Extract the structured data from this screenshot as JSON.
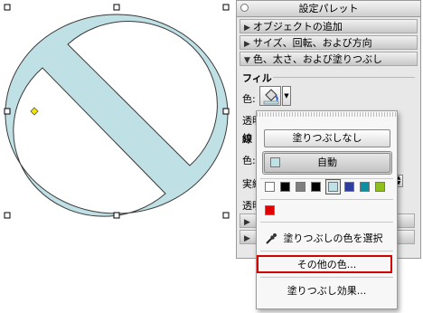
{
  "palette": {
    "title": "設定パレット",
    "sections": [
      {
        "label": "オブジェクトの追加",
        "expanded": false
      },
      {
        "label": "サイズ、回転、および方向",
        "expanded": false
      },
      {
        "label": "色、太さ、および塗りつぶし",
        "expanded": true
      }
    ],
    "fill_label": "フィル",
    "fill_color_label": "色:",
    "transparency_label_1": "透明",
    "line_label": "線",
    "line_color_label": "色:",
    "solid_label": "実線",
    "transparency_label_2": "透明"
  },
  "menu": {
    "no_fill_label": "塗りつぶしなし",
    "auto_label": "自動",
    "eyedropper_label": "塗りつぶしの色を選択",
    "other_colors_label": "その他の色...",
    "fill_effects_label": "塗りつぶし効果...",
    "swatches": [
      "#ffffff",
      "#000000",
      "#7f7f7f",
      "#000000",
      "#bfe0e4",
      "#2e3d9b",
      "#0e8fa1",
      "#8fbf1f"
    ],
    "recent_color": "#e00000"
  },
  "shape": {
    "fill_color": "#bfe0e4",
    "stroke_color": "#3a3a3a"
  },
  "icons": {
    "paint_bucket": "paint-bucket-icon",
    "eyedropper": "eyedropper-icon"
  }
}
